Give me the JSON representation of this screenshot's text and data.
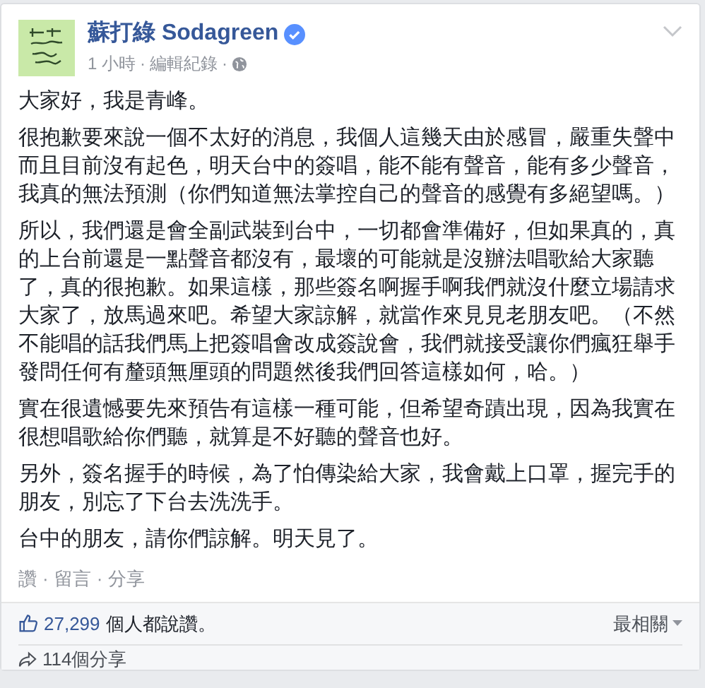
{
  "post": {
    "author": "蘇打綠 Sodagreen",
    "verified": true,
    "time": "1 小時",
    "edit_history": "編輯紀錄",
    "paragraphs": [
      "大家好，我是青峰。",
      "很抱歉要來說一個不太好的消息，我個人這幾天由於感冒，嚴重失聲中而且目前沒有起色，明天台中的簽唱，能不能有聲音，能有多少聲音，我真的無法預測（你們知道無法掌控自己的聲音的感覺有多絕望嗎。）",
      "所以，我們還是會全副武裝到台中，一切都會準備好，但如果真的，真的上台前還是一點聲音都沒有，最壞的可能就是沒辦法唱歌給大家聽了，真的很抱歉。如果這樣，那些簽名啊握手啊我們就沒什麼立場請求大家了，放馬過來吧。希望大家諒解，就當作來見見老朋友吧。（不然不能唱的話我們馬上把簽唱會改成簽說會，我們就接受讓你們瘋狂舉手發問任何有釐頭無厘頭的問題然後我們回答這樣如何，哈。）",
      "實在很遺憾要先來預告有這樣一種可能，但希望奇蹟出現，因為我實在很想唱歌給你們聽，就算是不好聽的聲音也好。",
      "另外，簽名握手的時候，為了怕傳染給大家，我會戴上口罩，握完手的朋友，別忘了下台去洗洗手。",
      "台中的朋友，請你們諒解。明天見了。"
    ],
    "actions": [
      "讚",
      "留言",
      "分享"
    ],
    "separator": "·"
  },
  "likes": {
    "count": "27,299",
    "text": "個人都說讚。",
    "sort": "最相關"
  },
  "shares": "114個分享"
}
